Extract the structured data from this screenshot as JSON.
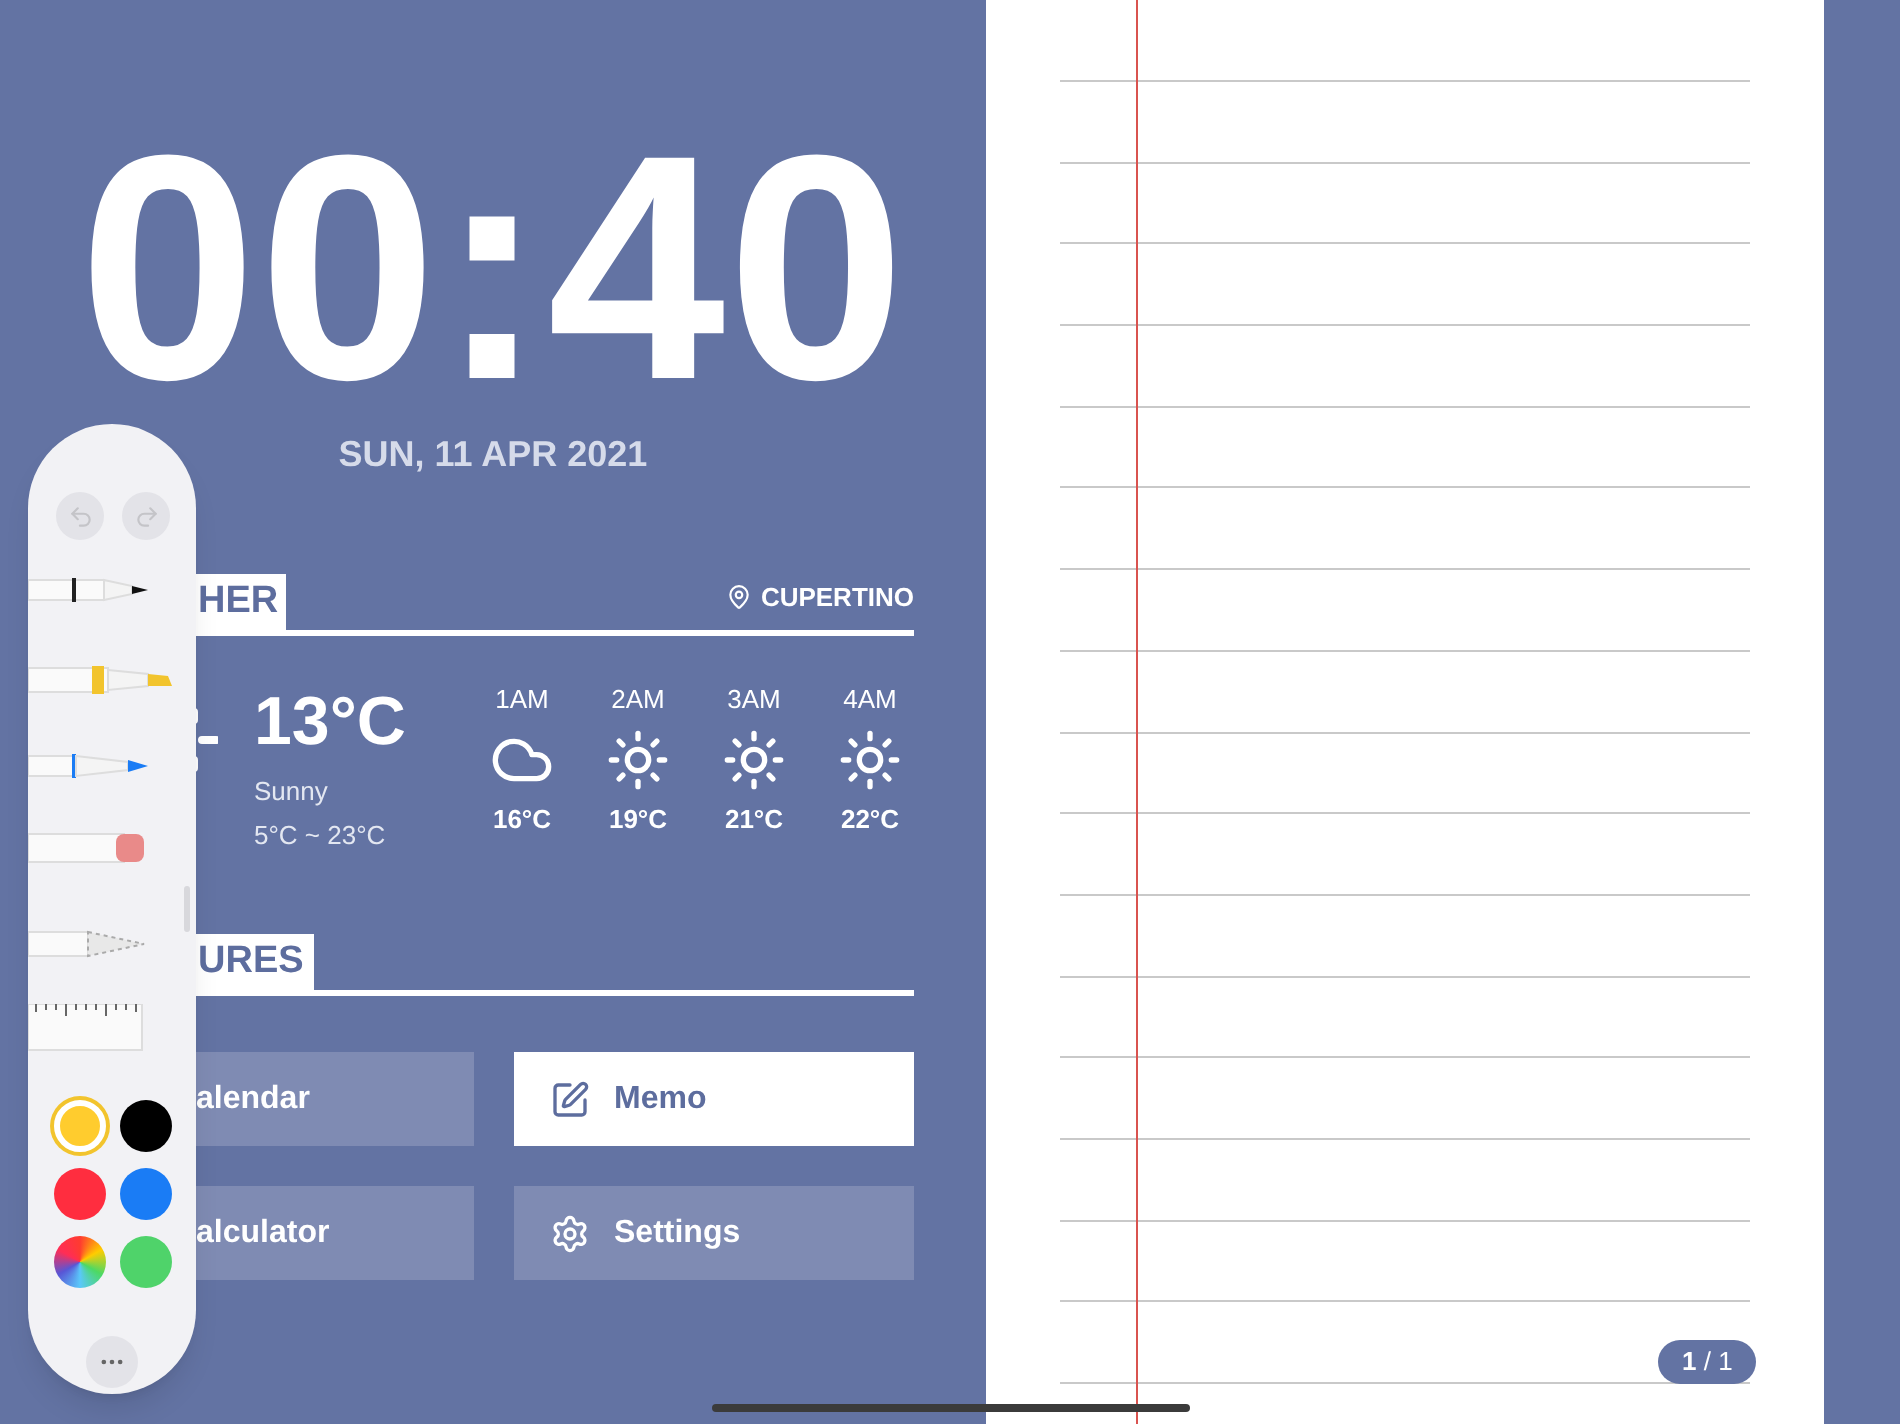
{
  "clock": {
    "time": "00:40",
    "date": "SUN, 11 APR 2021"
  },
  "weather": {
    "title": "HER",
    "location": "CUPERTINO",
    "current": {
      "temperature": "13°C",
      "condition": "Sunny",
      "range": "5°C ~ 23°C"
    },
    "hourly": [
      {
        "time": "1AM",
        "kind": "cloudy",
        "temperature": "16°C"
      },
      {
        "time": "2AM",
        "kind": "sunny",
        "temperature": "19°C"
      },
      {
        "time": "3AM",
        "kind": "sunny",
        "temperature": "21°C"
      },
      {
        "time": "4AM",
        "kind": "sunny",
        "temperature": "22°C"
      }
    ]
  },
  "features": {
    "title": "URES",
    "buttons": [
      {
        "label": "alendar",
        "kind": "calendar",
        "selected": false
      },
      {
        "label": "Memo",
        "kind": "memo",
        "selected": true
      },
      {
        "label": "alculator",
        "kind": "calculator",
        "selected": false
      },
      {
        "label": "Settings",
        "kind": "settings",
        "selected": false
      }
    ]
  },
  "palette": {
    "colors": [
      {
        "color": "#ffcc2e",
        "selected": true
      },
      {
        "color": "#000000",
        "selected": false
      },
      {
        "color": "#ff2d3f",
        "selected": false
      },
      {
        "color": "#1a7cf5",
        "selected": false
      },
      {
        "color": "#4fd36a",
        "selected": false
      }
    ]
  },
  "notebook": {
    "page_indicator": "**1** / 1"
  }
}
